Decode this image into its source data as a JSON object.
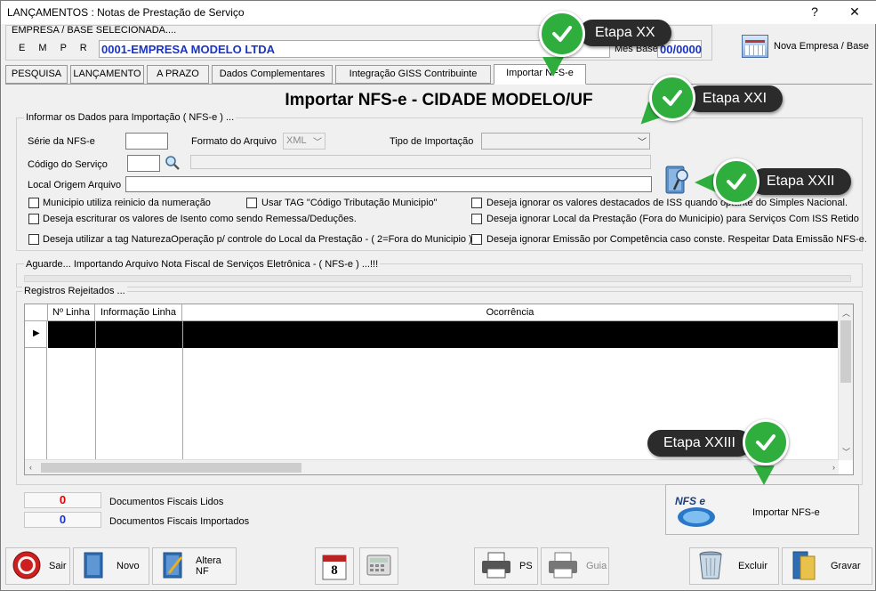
{
  "window": {
    "title": "LANÇAMENTOS : Notas de Prestação de Serviço",
    "help_glyph": "?",
    "close_glyph": "✕"
  },
  "empresa": {
    "header": "EMPRESA  /  BASE  SELECIONADA....",
    "label": "E M P R E S A",
    "name": "0001-EMPRESA MODELO LTDA",
    "mes_base_label": "Mes Base",
    "mes_base_value": "00/0000",
    "nova_label": "Nova Empresa / Base"
  },
  "tabs": [
    {
      "label": "PESQUISA"
    },
    {
      "label": "LANÇAMENTO"
    },
    {
      "label": "A PRAZO"
    },
    {
      "label": "Dados Complementares"
    },
    {
      "label": "Integração  GISS Contribuinte"
    },
    {
      "label": "Importar NFS-e"
    }
  ],
  "heading": "Importar NFS-e - CIDADE MODELO/UF",
  "form": {
    "group_label": "Informar os Dados para Importação ( NFS-e ) ...",
    "serie_label": "Série da NFS-e",
    "serie_value": "",
    "formato_label": "Formato do Arquivo",
    "formato_value": "XML",
    "tipo_label": "Tipo de Importação",
    "tipo_value": "",
    "codigo_label": "Código do Serviço",
    "codigo_value": "",
    "codigo_desc": "",
    "local_label": "Local Origem Arquivo",
    "local_value": ""
  },
  "options": [
    "Municipio utiliza reinicio da numeração",
    "Usar TAG \"Código Tributação Municipio\"",
    "Deseja ignorar os valores destacados de ISS quando optante do Simples Nacional.",
    "Deseja escriturar os valores de Isento como sendo Remessa/Deduções.",
    "Deseja ignorar Local da Prestação (Fora do Municipio)  para Serviços Com ISS Retido",
    "Deseja utilizar a tag NaturezaOperação p/ controle do Local da Prestação - ( 2=Fora do Municipio )",
    "Deseja ignorar Emissão por Competência caso conste. Respeitar Data Emissão NFS-e."
  ],
  "status_text": "Aguarde... Importando Arquivo Nota Fiscal de Serviços Eletrônica - ( NFS-e ) ...!!!",
  "progress": 0,
  "rejected": {
    "group_label": "Registros Rejeitados ...",
    "columns": [
      "Nº Linha",
      "Informação Linha",
      "Ocorrência"
    ],
    "row_marker": "▶"
  },
  "counters": {
    "lidos_value": "0",
    "lidos_label": "Documentos Fiscais Lidos",
    "importados_value": "0",
    "importados_label": "Documentos Fiscais Importados"
  },
  "import_button": {
    "label": "Importar NFS-e",
    "logo_text": "NFS e"
  },
  "toolbar": {
    "sair": "Sair",
    "novo": "Novo",
    "altera": "Altera NF",
    "calendar_day": "8",
    "ps": "PS",
    "guia": "Guia",
    "excluir": "Excluir",
    "gravar": "Gravar"
  },
  "callouts": {
    "xx": "Etapa XX",
    "xxi": "Etapa XXI",
    "xxii": "Etapa XXII",
    "xxiii": "Etapa XXIII"
  },
  "colors": {
    "accent_blue": "#1a33c8",
    "lidos": "#e00000",
    "importados": "#1a33c8",
    "check_green": "#2fae3e",
    "callout_bg": "#2b2b2b"
  }
}
